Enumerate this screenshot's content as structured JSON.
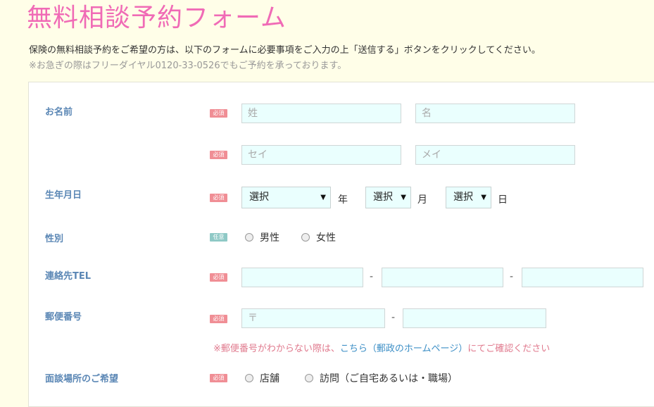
{
  "page": {
    "title": "無料相談予約フォーム",
    "intro": "保険の無料相談予約をご希望の方は、以下のフォームに必要事項をご入力の上「送信する」ボタンをクリックしてください。",
    "note": "※お急ぎの際はフリーダイヤル0120-33-0526でもご予約を承っております。"
  },
  "badges": {
    "required": "必須",
    "optional": "任意"
  },
  "form": {
    "name": {
      "label": "お名前",
      "last_placeholder": "姓",
      "first_placeholder": "名",
      "last_kana_placeholder": "セイ",
      "first_kana_placeholder": "メイ"
    },
    "birthday": {
      "label": "生年月日",
      "year_value": "選択",
      "year_unit": "年",
      "month_value": "選択",
      "month_unit": "月",
      "day_value": "選択",
      "day_unit": "日"
    },
    "gender": {
      "label": "性別",
      "options": [
        "男性",
        "女性"
      ]
    },
    "tel": {
      "label": "連絡先TEL",
      "separator": "-"
    },
    "postal": {
      "label": "郵便番号",
      "prefix_placeholder": "〒",
      "separator": "-",
      "note_prefix": "※郵便番号がわからない際は、",
      "note_link": "こちら（郵政のホームページ）",
      "note_suffix": "にてご確認ください"
    },
    "location": {
      "label": "面談場所のご希望",
      "options": [
        "店舗",
        "訪問（ご自宅あるいは・職場）"
      ]
    }
  },
  "colors": {
    "title": "#f06bb6",
    "label": "#5b87b5",
    "required_badge": "#f08e95",
    "optional_badge": "#8fc9c6",
    "input_bg": "#eafffe"
  }
}
